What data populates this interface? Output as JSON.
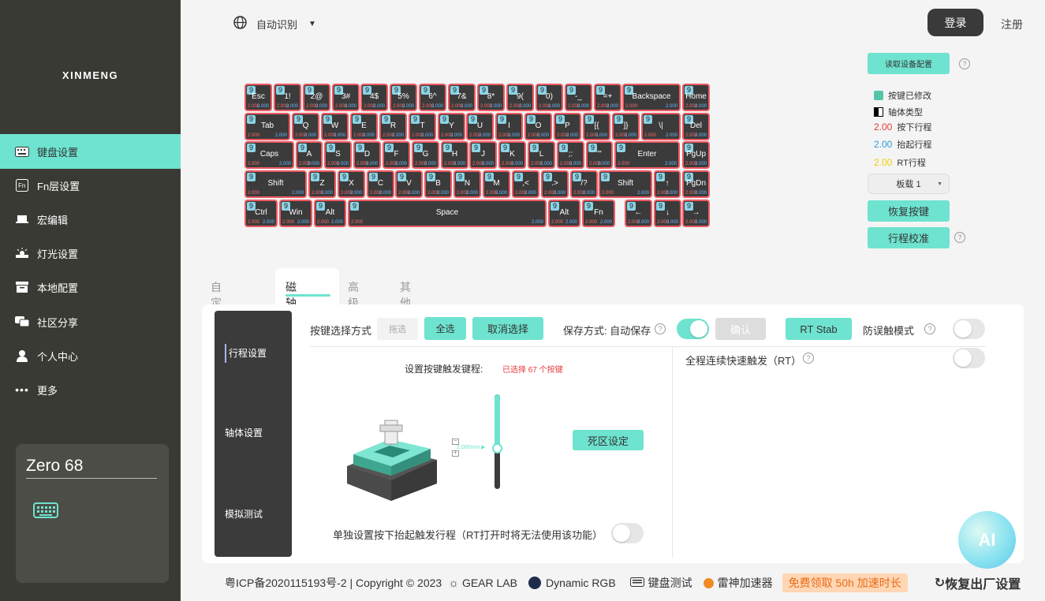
{
  "brand": "XINMENG",
  "sidebar": {
    "items": [
      {
        "label": "键盘设置",
        "icon": "keyboard-icon",
        "active": true
      },
      {
        "label": "Fn层设置",
        "icon": "fn-icon"
      },
      {
        "label": "宏编辑",
        "icon": "laptop-icon"
      },
      {
        "label": "灯光设置",
        "icon": "light-icon"
      },
      {
        "label": "本地配置",
        "icon": "box-icon"
      },
      {
        "label": "社区分享",
        "icon": "community-icon"
      },
      {
        "label": "个人中心",
        "icon": "user-icon"
      },
      {
        "label": "更多",
        "icon": "more-icon"
      }
    ],
    "device_name": "Zero 68"
  },
  "topbar": {
    "language": "自动识别",
    "login": "登录",
    "register": "注册"
  },
  "keyboard": {
    "value_label": "9",
    "down_value": "2.000",
    "up_value": "2.000",
    "rows": [
      [
        "Esc",
        "1!",
        "2@",
        "3#",
        "4$",
        "5%",
        "6^",
        "7&",
        "8*",
        "9(",
        "0)",
        "-_",
        "=+",
        "Backspace",
        "Home"
      ],
      [
        "Tab",
        "Q",
        "W",
        "E",
        "R",
        "T",
        "Y",
        "U",
        "I",
        "O",
        "P",
        "[{",
        "]}",
        "\\|",
        "Del"
      ],
      [
        "Caps",
        "A",
        "S",
        "D",
        "F",
        "G",
        "H",
        "J",
        "K",
        "L",
        ";:",
        "'\"",
        "Enter",
        "PgUp"
      ],
      [
        "Shift",
        "Z",
        "X",
        "C",
        "V",
        "B",
        "N",
        "M",
        ",<",
        ".>",
        "/?",
        "Shift",
        "↑",
        "PgDn"
      ],
      [
        "Ctrl",
        "Win",
        "Alt",
        "Space",
        "Alt",
        "Fn",
        "←",
        "↓",
        "→"
      ]
    ]
  },
  "right_panel": {
    "read_config": "读取设备配置",
    "legend": {
      "modified": "按键已修改",
      "switch_type": "轴体类型",
      "down_val": "2.00",
      "down_label": "按下行程",
      "up_val": "2.00",
      "up_label": "抬起行程",
      "rt_val": "2.00",
      "rt_label": "RT行程"
    },
    "profile": "板载 1",
    "restore_keys": "恢复按键",
    "calibrate": "行程校准",
    "colors": {
      "modified": "#55c4a8",
      "down": "#e8383d",
      "up": "#2f9bdc",
      "rt": "#f0d000"
    }
  },
  "tabs": [
    "自定义按键",
    "磁轴设置",
    "高级键",
    "其他设置"
  ],
  "panel": {
    "subnav": [
      "行程设置",
      "轴体设置",
      "模拟测试"
    ],
    "select_mode": "按键选择方式",
    "drag": "拖选",
    "select_all": "全选",
    "deselect": "取消选择",
    "save_mode": "保存方式: 自动保存",
    "confirm": "确认",
    "rt_stab": "RT Stab",
    "anti_mistouch": "防误触模式",
    "full_rt": "全程连续快速触发（RT）",
    "trigger_title": "设置按键触发键程:",
    "selected_info": "已选择 67 个按键",
    "slider_value": "2.000mm",
    "deadzone": "死区设定",
    "separate": "单独设置按下抬起触发行程（RT打开时将无法使用该功能）"
  },
  "footer": {
    "icp": "粤ICP备2020115193号-2 | Copyright © 2023",
    "gearlab": "GEAR LAB",
    "dynamic": "Dynamic RGB",
    "kbdtest": "键盘测试",
    "leishen": "雷神加速器",
    "promo": "免费领取 50h 加速时长",
    "reset": "恢复出厂设置"
  }
}
